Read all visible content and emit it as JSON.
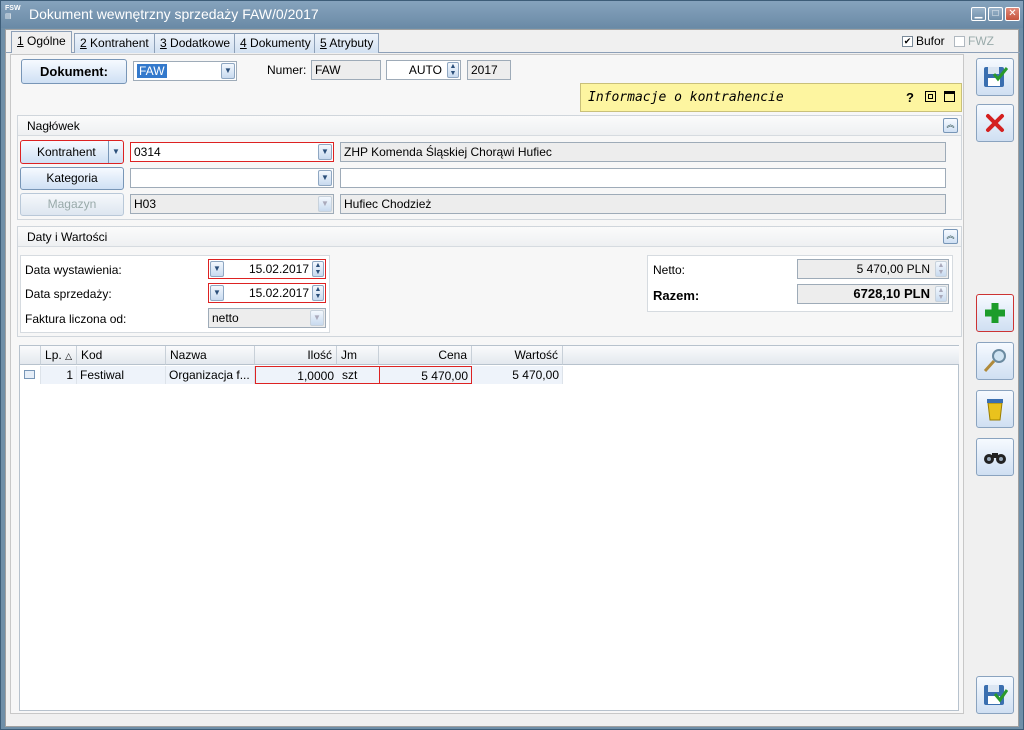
{
  "window": {
    "app_icon_text": "FSW",
    "title": "Dokument wewnętrzny sprzedaży FAW/0/2017",
    "min": "▁",
    "max": "□",
    "close": "✕"
  },
  "tabs": [
    {
      "key": "1",
      "label": " Ogólne"
    },
    {
      "key": "2",
      "label": " Kontrahent"
    },
    {
      "key": "3",
      "label": " Dodatkowe"
    },
    {
      "key": "4",
      "label": " Dokumenty"
    },
    {
      "key": "5",
      "label": " Atrybuty"
    }
  ],
  "flags": {
    "bufor_label": "Bufor",
    "bufor_checked": "✔",
    "fwz_label": "FWZ"
  },
  "document": {
    "button_label": "Dokument:",
    "type_value": "FAW",
    "numer_label": "Numer:",
    "numer_prefix": "FAW",
    "numer_auto": "AUTO",
    "numer_year": "2017"
  },
  "info_panel": {
    "title": "Informacje o kontrahencie",
    "help": "?"
  },
  "naglowek": {
    "title": "Nagłówek",
    "kontrahent_button": "Kontrahent",
    "kontrahent_code": "0314",
    "kontrahent_name": "ZHP Komenda Śląskiej Chorąwi Hufiec",
    "kategoria_button": "Kategoria",
    "kategoria_value": "",
    "kategoria_desc": "",
    "magazyn_button": "Magazyn",
    "magazyn_code": "H03",
    "magazyn_name": "Hufiec Chodzież"
  },
  "daty": {
    "title": "Daty i Wartości",
    "data_wystawienia_label": "Data wystawienia:",
    "data_wystawienia": "15.02.2017",
    "data_sprzedazy_label": "Data sprzedaży:",
    "data_sprzedazy": "15.02.2017",
    "faktura_od_label": "Faktura liczona od:",
    "faktura_od": "netto",
    "netto_label": "Netto:",
    "netto_value": "5 470,00 PLN",
    "razem_label": "Razem:",
    "razem_value": "6728,10 PLN"
  },
  "grid": {
    "columns": [
      "Lp.",
      "Kod",
      "Nazwa",
      "Ilość",
      "Jm",
      "Cena",
      "Wartość"
    ],
    "sort_indicator": "△",
    "rows": [
      {
        "lp": "1",
        "kod": "Festiwal",
        "nazwa": "Organizacja f...",
        "ilosc": "1,0000",
        "jm": "szt",
        "cena": "5 470,00",
        "wartosc": "5 470,00"
      }
    ]
  },
  "colors": {
    "accent_red": "#d22222",
    "info_yellow": "#fdf5a0",
    "titlebar": "#7594b0"
  }
}
